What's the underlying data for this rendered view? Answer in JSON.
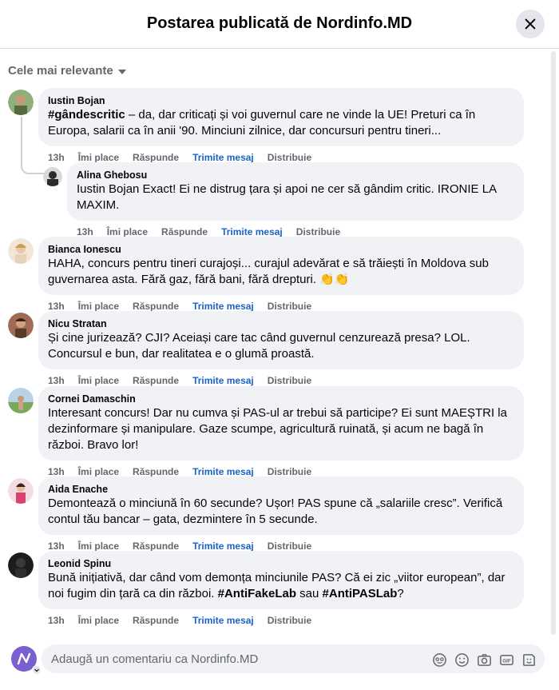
{
  "header": {
    "title": "Postarea publicată de Nordinfo.MD"
  },
  "sort": {
    "label": "Cele mai relevante"
  },
  "actions": {
    "time": "13h",
    "like": "Îmi place",
    "reply": "Răspunde",
    "message": "Trimite mesaj",
    "share": "Distribuie"
  },
  "comments": [
    {
      "author": "Iustin Bojan",
      "hashtag": "#gândescritic",
      "text": " – da, dar criticați și voi guvernul care ne vinde la UE! Preturi ca în Europa, salarii ca în anii '90. Minciuni zilnice, dar concursuri pentru tineri...",
      "avatar_color": "#6b8e4e"
    },
    {
      "author": "Alina Ghebosu",
      "text": "Iustin Bojan Exact! Ei ne distrug țara și apoi ne cer să gândim critic. IRONIE LA MAXIM.",
      "avatar_color": "#2b2b2b"
    },
    {
      "author": "Bianca Ionescu",
      "text": "HAHA, concurs pentru tineri curajoși... curajul adevărat e să trăiești în Moldova sub guvernarea asta. Fără gaz, fără bani, fără drepturi. 👏👏",
      "avatar_color": "#e8c9a8"
    },
    {
      "author": "Nicu Stratan",
      "text": "Și cine jurizează? CJI? Aceiași care tac când guvernul cenzurează presa? LOL. Concursul e bun, dar realitatea e o glumă proastă.",
      "avatar_color": "#7a4a3a"
    },
    {
      "author": "Cornei Damaschin",
      "text": "Interesant concurs! Dar nu cumva și PAS-ul ar trebui să participe? Ei sunt MAEȘTRI la dezinformare și manipulare. Gaze scumpe, agricultură ruinată, și acum ne bagă în război. Bravo lor!",
      "avatar_color": "#8ab06a"
    },
    {
      "author": "Aida Enache",
      "text": "Demontează o minciună în 60 secunde? Ușor! PAS spune că „salariile cresc”. Verifică contul tău bancar – gata, dezmintere în 5 secunde.",
      "avatar_color": "#d98aa0"
    },
    {
      "author": "Leonid Spinu",
      "text_a": "Bună inițiativă, dar când vom demonța minciunile PAS? Că ei zic „viitor european”, dar noi fugim din țară ca din război. ",
      "tag1": "#AntiFakeLab",
      "mid": " sau ",
      "tag2": "#AntiPASLab",
      "end": "?",
      "avatar_color": "#1c1c1c"
    }
  ],
  "composer": {
    "placeholder": "Adaugă un comentariu ca Nordinfo.MD"
  }
}
